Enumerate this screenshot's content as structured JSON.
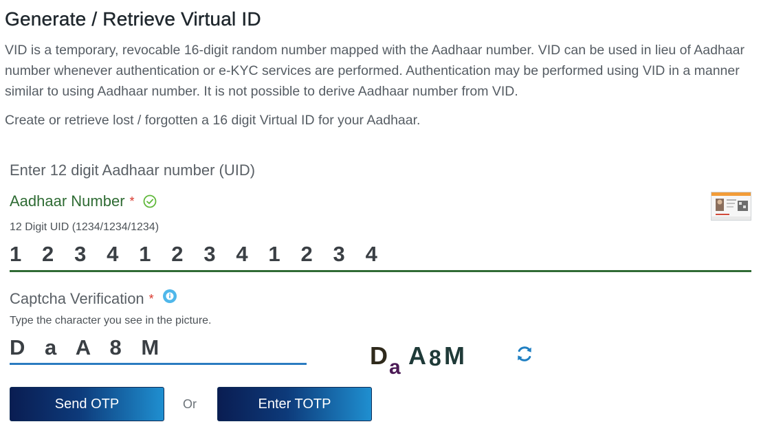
{
  "header": {
    "title": "Generate / Retrieve Virtual ID"
  },
  "intro": {
    "description": "VID is a temporary, revocable 16-digit random number mapped with the Aadhaar number. VID can be used in lieu of Aadhaar number whenever authentication or e-KYC services are performed. Authentication may be performed using VID in a manner similar to using Aadhaar number. It is not possible to derive Aadhaar number from VID.",
    "subtext": "Create or retrieve lost / forgotten a 16 digit Virtual ID for your Aadhaar."
  },
  "form": {
    "section_label": "Enter 12 digit Aadhaar number (UID)",
    "aadhaar": {
      "label": "Aadhaar Number",
      "required_mark": "*",
      "hint": "12 Digit UID (1234/1234/1234)",
      "value": "1 2 3 4 1 2 3 4 1 2 3 4",
      "status_icon": "check-circle-icon",
      "card_icon": "aadhaar-card-icon",
      "accent_color": "#2f6b34"
    },
    "captcha": {
      "label": "Captcha Verification",
      "required_mark": "*",
      "hint": "Type the character you see in the picture.",
      "value": "D a A 8 M",
      "image_text": "DaA8M",
      "info_icon": "info-icon",
      "refresh_icon": "refresh-icon",
      "accent_color": "#2a7bc0"
    },
    "actions": {
      "send_otp_label": "Send OTP",
      "or_label": "Or",
      "enter_totp_label": "Enter TOTP"
    }
  }
}
